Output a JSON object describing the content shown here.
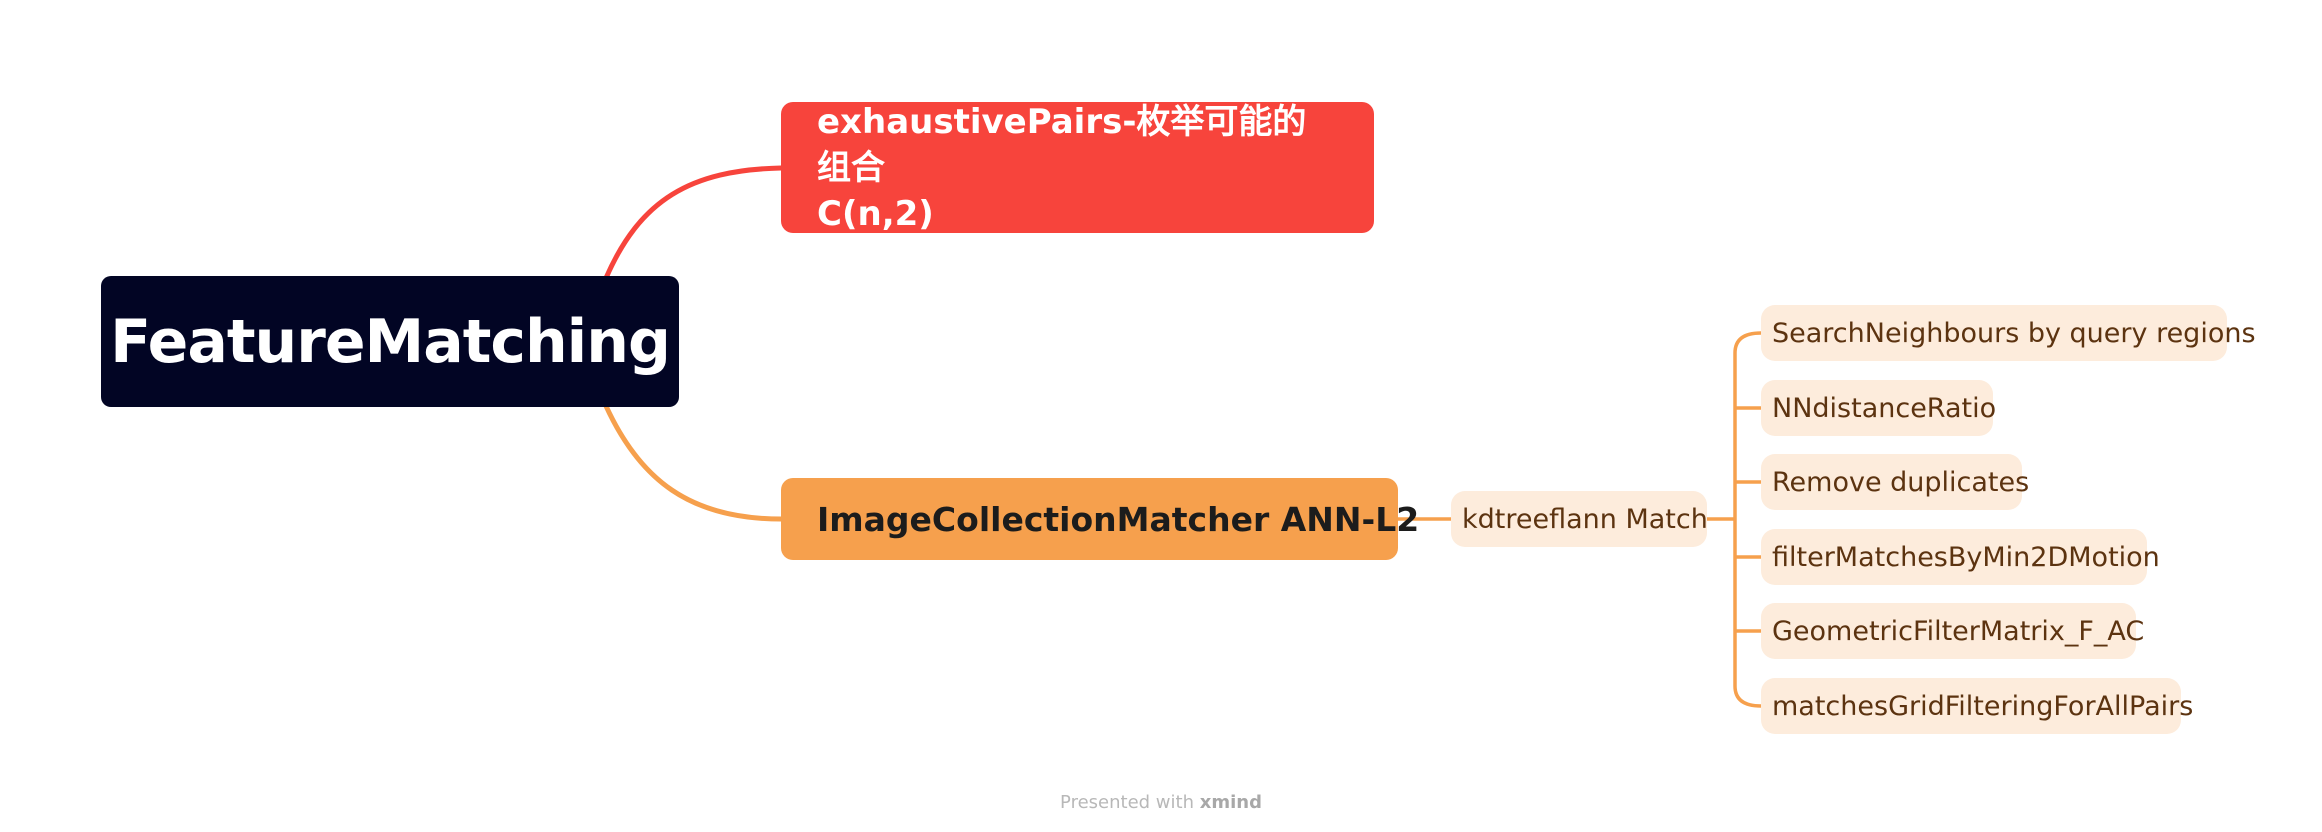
{
  "root": {
    "label": "FeatureMatching"
  },
  "branches": [
    {
      "label_lines": [
        "exhaustivePairs-枚举可能的组合",
        "C(n,2)"
      ],
      "color": "#f7443c"
    },
    {
      "label": "ImageCollectionMatcher ANN-L2",
      "color": "#f6a04d",
      "child": {
        "label": "kdtreeflann Match",
        "children": [
          "SearchNeighbours by query regions",
          "NNdistanceRatio",
          "Remove duplicates",
          "filterMatchesByMin2DMotion",
          "GeometricFilterMatrix_F_AC",
          "matchesGridFilteringForAllPairs"
        ]
      }
    }
  ],
  "colors": {
    "root_bg": "#020524",
    "sub_bg": "#fdecdc",
    "sub_text": "#5c3310",
    "line_orange": "#f6a04d",
    "line_red": "#f7443c"
  },
  "footer": {
    "prefix": "Presented with",
    "brand": "xmind"
  }
}
